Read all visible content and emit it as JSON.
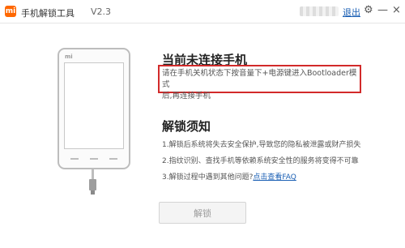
{
  "titlebar": {
    "logo_text": "mi",
    "app_title": "手机解锁工具",
    "version": "V2.3",
    "logout_label": "退出",
    "gear_icon": "gear-icon",
    "minimize_glyph": "—",
    "close_glyph": "×"
  },
  "phone": {
    "logo_text": "mi"
  },
  "main": {
    "status_title": "当前未连接手机",
    "instruction_line1": "请在手机关机状态下按音量下+电源键进入Bootloader模式",
    "instruction_line2": "后,再连接手机",
    "notice_title": "解锁须知",
    "notes": [
      "1.解锁后系统将失去安全保护,导致您的隐私被泄露或财产损失",
      "2.指纹识别、查找手机等依赖系统安全性的服务将变得不可靠"
    ],
    "note3_prefix": "3.解锁过程中遇到其他问题?",
    "faq_link": "点击查看FAQ",
    "unlock_button": "解锁"
  },
  "colors": {
    "brand": "#ff6700",
    "highlight_border": "#d22a2a",
    "link": "#1a5fb4"
  }
}
